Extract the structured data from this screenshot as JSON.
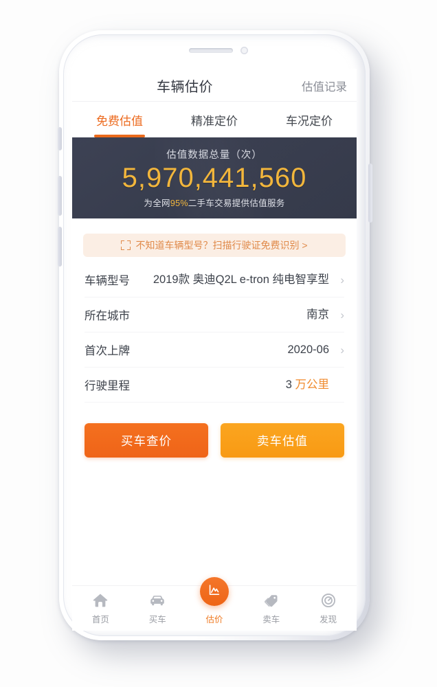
{
  "header": {
    "title": "车辆估价",
    "history_link": "估值记录"
  },
  "tabs": [
    {
      "label": "免费估值",
      "active": true
    },
    {
      "label": "精准定价",
      "active": false
    },
    {
      "label": "车况定价",
      "active": false
    }
  ],
  "stat_banner": {
    "label": "估值数据总量（次）",
    "number": "5,970,441,560",
    "sub_prefix": "为全网",
    "sub_highlight": "95%",
    "sub_suffix": "二手车交易提供估值服务",
    "number_color": "#f2b63c",
    "background_color": "#313648"
  },
  "scan_banner": {
    "icon": "scan-frame-icon",
    "text": "不知道车辆型号？扫描行驶证免费识别 >"
  },
  "form_rows": [
    {
      "label": "车辆型号",
      "value": "2019款 奥迪Q2L e-tron 纯电智享型",
      "unit": "",
      "chevron": true
    },
    {
      "label": "所在城市",
      "value": "南京",
      "unit": "",
      "chevron": true
    },
    {
      "label": "首次上牌",
      "value": "2020-06",
      "unit": "",
      "chevron": true
    },
    {
      "label": "行驶里程",
      "value": "3",
      "unit": "万公里",
      "chevron": false
    }
  ],
  "cta_buttons": [
    {
      "label": "买车查价",
      "color": "#ef6418"
    },
    {
      "label": "卖车估值",
      "color": "#f89a13"
    }
  ],
  "bottom_nav": [
    {
      "label": "首页",
      "icon": "home-icon",
      "active": false
    },
    {
      "label": "买车",
      "icon": "car-icon",
      "active": false
    },
    {
      "label": "估价",
      "icon": "chart-icon",
      "active": true
    },
    {
      "label": "卖车",
      "icon": "tag-icon",
      "active": false
    },
    {
      "label": "发现",
      "icon": "compass-icon",
      "active": false
    }
  ],
  "accent_color": "#ef6a1c"
}
